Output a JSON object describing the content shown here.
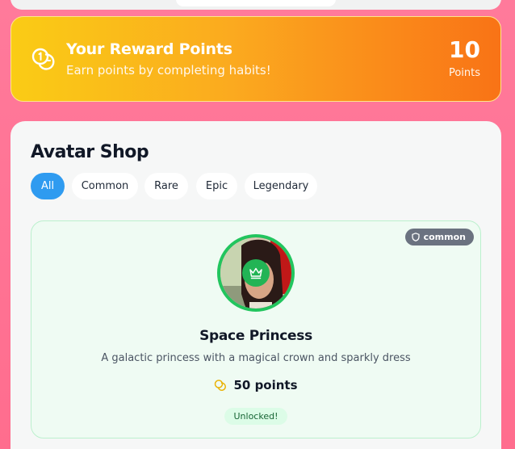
{
  "rewards": {
    "title": "Your Reward Points",
    "subtitle": "Earn points by completing habits!",
    "points_value": "10",
    "points_unit": "Points",
    "icon": "coins-icon"
  },
  "shop": {
    "title": "Avatar Shop",
    "filters": [
      {
        "label": "All",
        "active": true
      },
      {
        "label": "Common",
        "active": false
      },
      {
        "label": "Rare",
        "active": false
      },
      {
        "label": "Epic",
        "active": false
      },
      {
        "label": "Legendary",
        "active": false
      }
    ],
    "items": [
      {
        "name": "Space Princess",
        "description": "A galactic princess with a magical crown and sparkly dress",
        "rarity": "common",
        "price": "50 points",
        "status": "Unlocked!",
        "badge_icon": "crown-icon"
      }
    ]
  },
  "colors": {
    "background": "#ff7a9b",
    "banner_start": "#facc15",
    "banner_end": "#f97316",
    "filter_active": "#2f9bf0",
    "card_border": "#bbf0cd",
    "avatar_ring": "#22c55e",
    "rarity_badge": "#6b7280"
  }
}
